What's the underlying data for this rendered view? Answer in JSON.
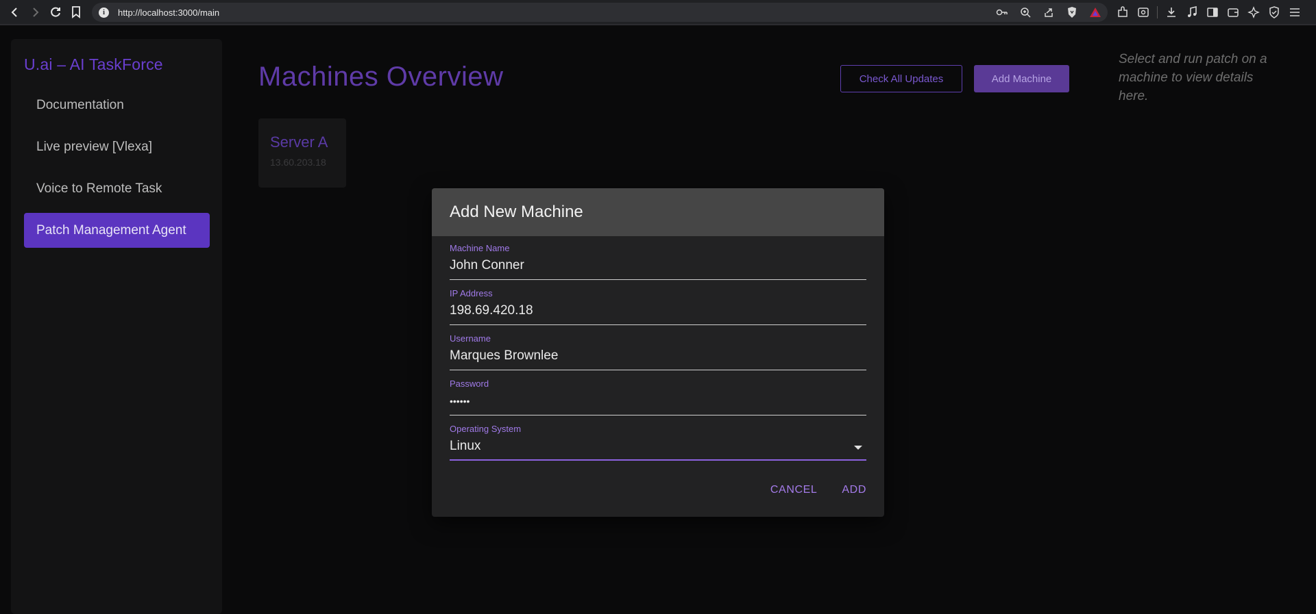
{
  "browser": {
    "url": "http://localhost:3000/main"
  },
  "sidebar": {
    "brand": "U.ai – AI TaskForce",
    "items": [
      {
        "label": "Documentation"
      },
      {
        "label": "Live preview [Vlexa]"
      },
      {
        "label": "Voice to Remote Task"
      },
      {
        "label": "Patch Management Agent",
        "active": true
      }
    ]
  },
  "main": {
    "title": "Machines Overview",
    "check_updates_label": "Check All Updates",
    "add_machine_label": "Add Machine",
    "hint": "Select and run patch on a machine to view details here.",
    "machines": [
      {
        "name": "Server A",
        "ip": "13.60.203.18"
      }
    ]
  },
  "dialog": {
    "title": "Add New Machine",
    "fields": {
      "machine_name": {
        "label": "Machine Name",
        "value": "John Conner"
      },
      "ip_address": {
        "label": "IP Address",
        "value": "198.69.420.18"
      },
      "username": {
        "label": "Username",
        "value": "Marques Brownlee"
      },
      "password": {
        "label": "Password",
        "value": "••••••"
      },
      "os": {
        "label": "Operating System",
        "value": "Linux"
      }
    },
    "cancel_label": "CANCEL",
    "add_label": "ADD"
  },
  "colors": {
    "accent": "#5b35c0",
    "accent_text": "#a07ae8",
    "background": "#0a0a0b"
  }
}
